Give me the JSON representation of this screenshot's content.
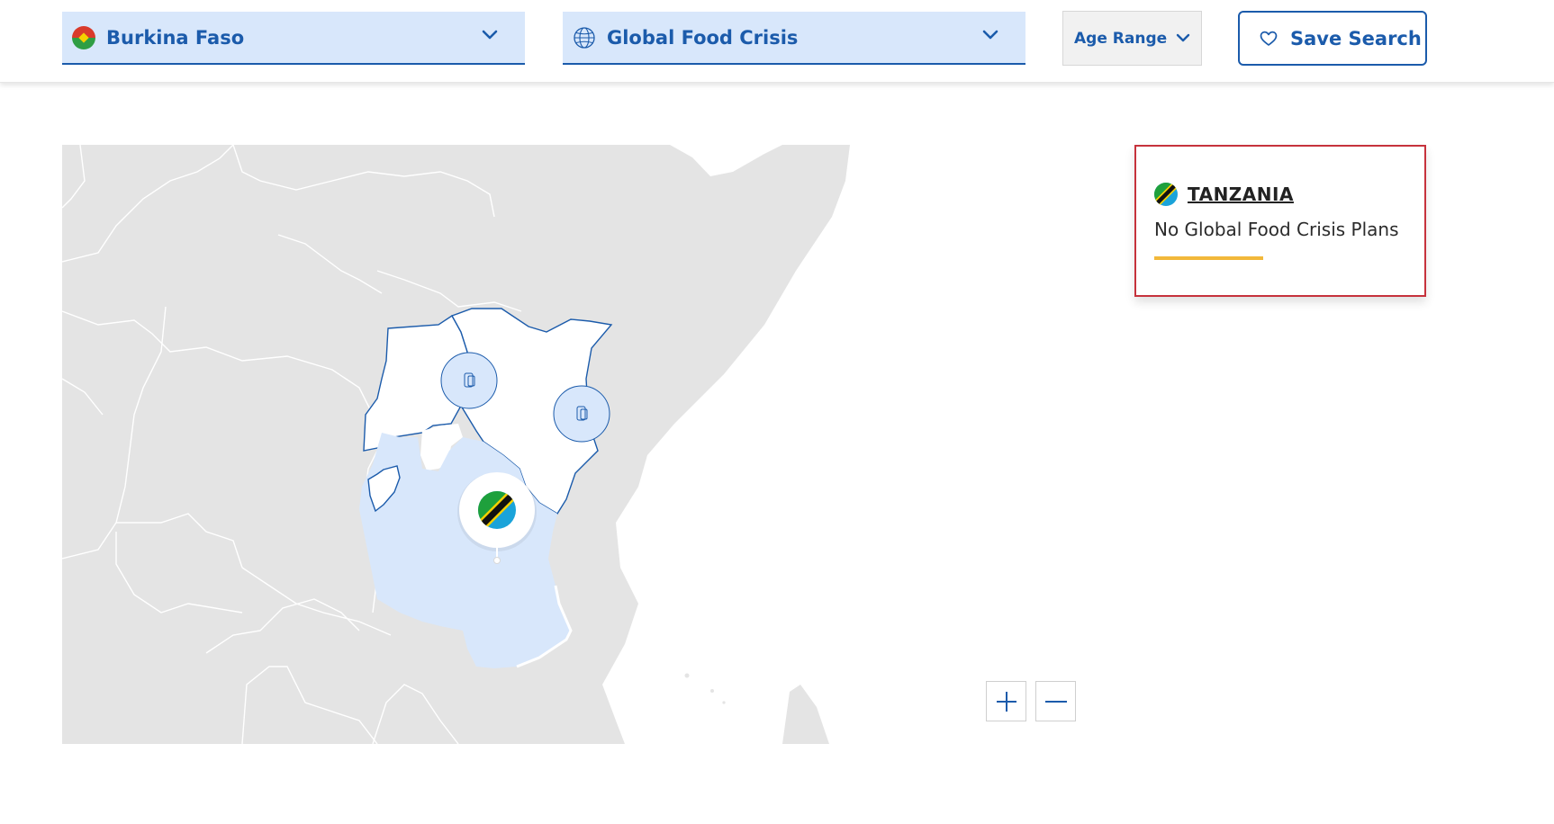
{
  "filters": {
    "country": {
      "label": "Burkina Faso",
      "flag_icon": "burkina-faso-flag-icon"
    },
    "topic": {
      "label": "Global Food Crisis",
      "icon": "globe-icon"
    },
    "age_range": {
      "label": "Age Range"
    },
    "save_search": {
      "label": "Save Search",
      "icon": "heart-icon"
    }
  },
  "map": {
    "highlighted_country": "Tanzania",
    "selected_marker_icon": "tanzania-flag-icon",
    "region_markers": [
      {
        "icon": "phone-icon"
      },
      {
        "icon": "phone-icon"
      }
    ],
    "zoom_in_icon": "plus-icon",
    "zoom_out_icon": "minus-icon"
  },
  "info_card": {
    "country": "TANZANIA",
    "description": "No Global Food Crisis Plans",
    "flag_icon": "tanzania-flag-icon"
  },
  "colors": {
    "brand_blue": "#1b5bab",
    "select_bg": "#d8e7fb",
    "land_gray": "#e4e4e4",
    "card_border": "#c6323c",
    "accent_yellow": "#f2b83a"
  }
}
